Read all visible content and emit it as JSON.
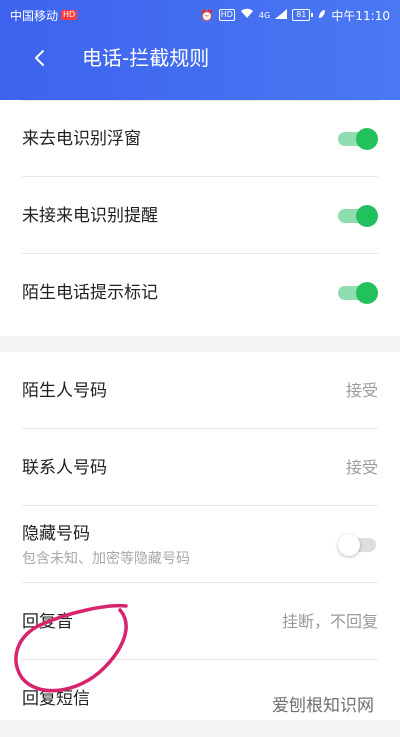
{
  "status_bar": {
    "carrier": "中国移动",
    "carrier_badge": "HD",
    "hd": "HD",
    "network": "4G",
    "battery": "81",
    "time": "中午11:10"
  },
  "header": {
    "title": "电话-拦截规则"
  },
  "settings_group_1": [
    {
      "label": "来去电识别浮窗",
      "enabled": true
    },
    {
      "label": "未接来电识别提醒",
      "enabled": true
    },
    {
      "label": "陌生电话提示标记",
      "enabled": true
    }
  ],
  "settings_group_2": {
    "stranger": {
      "label": "陌生人号码",
      "value": "接受"
    },
    "contacts": {
      "label": "联系人号码",
      "value": "接受"
    },
    "hidden": {
      "label": "隐藏号码",
      "sub": "包含未知、加密等隐藏号码",
      "enabled": false
    },
    "reply_tone": {
      "label": "回复音",
      "value": "挂断，不回复"
    },
    "reply_sms": {
      "label": "回复短信"
    }
  },
  "watermark": "爱刨根知识网",
  "colors": {
    "header_start": "#3d63ee",
    "header_end": "#4a78f3",
    "toggle_on": "#22c15e",
    "annotation": "#d6246e"
  }
}
